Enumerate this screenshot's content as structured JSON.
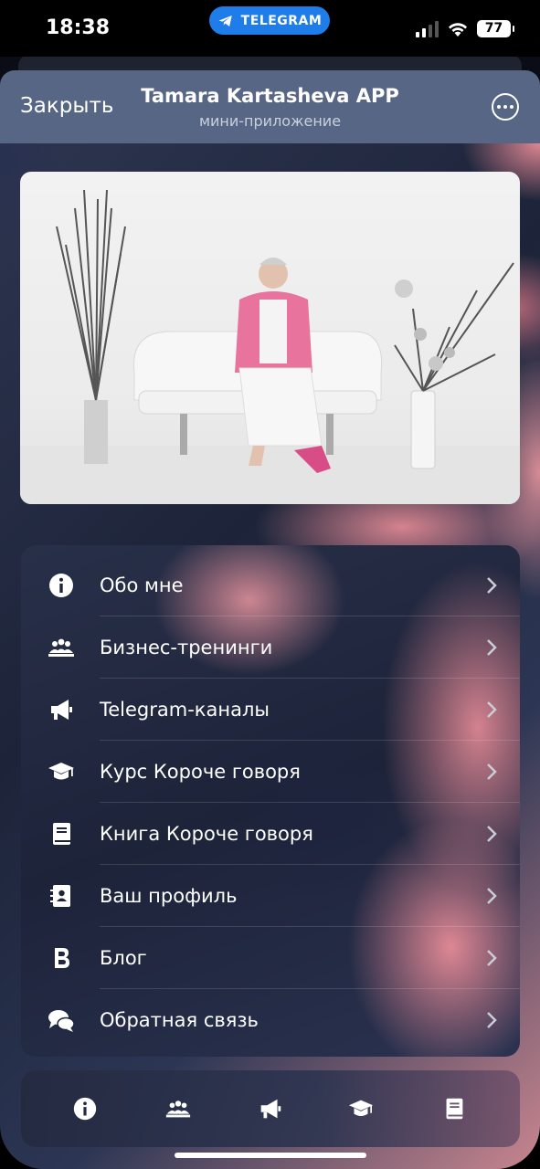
{
  "status_bar": {
    "time": "18:38",
    "telegram_pill": "TELEGRAM",
    "battery": "77",
    "signal_icon": "cellular-signal-icon",
    "wifi_icon": "wifi-icon"
  },
  "header": {
    "close_label": "Закрыть",
    "title": "Tamara Kartasheva APP",
    "subtitle": "мини-приложение",
    "more_icon": "more-options-icon"
  },
  "hero": {
    "image_alt": "Portrait photo: woman in pink jacket seated on white sofa"
  },
  "menu": {
    "items": [
      {
        "label": "Обо мне",
        "icon": "info-icon"
      },
      {
        "label": "Бизнес-тренинги",
        "icon": "group-icon"
      },
      {
        "label": "Telegram-каналы",
        "icon": "megaphone-icon"
      },
      {
        "label": "Курс Короче говоря",
        "icon": "graduation-cap-icon"
      },
      {
        "label": "Книга Короче говоря",
        "icon": "book-icon"
      },
      {
        "label": "Ваш профиль",
        "icon": "contact-card-icon"
      },
      {
        "label": "Блог",
        "icon": "blog-b-icon"
      },
      {
        "label": "Обратная связь",
        "icon": "chat-bubbles-icon"
      }
    ]
  },
  "bottom_nav": {
    "items": [
      {
        "icon": "info-icon"
      },
      {
        "icon": "group-icon"
      },
      {
        "icon": "megaphone-icon"
      },
      {
        "icon": "graduation-cap-icon"
      },
      {
        "icon": "book-icon"
      }
    ]
  },
  "colors": {
    "header_bg": "#566684",
    "telegram_blue": "#1f7de9",
    "accent_pink": "#e78b95",
    "dark_navy": "#1d2339"
  }
}
